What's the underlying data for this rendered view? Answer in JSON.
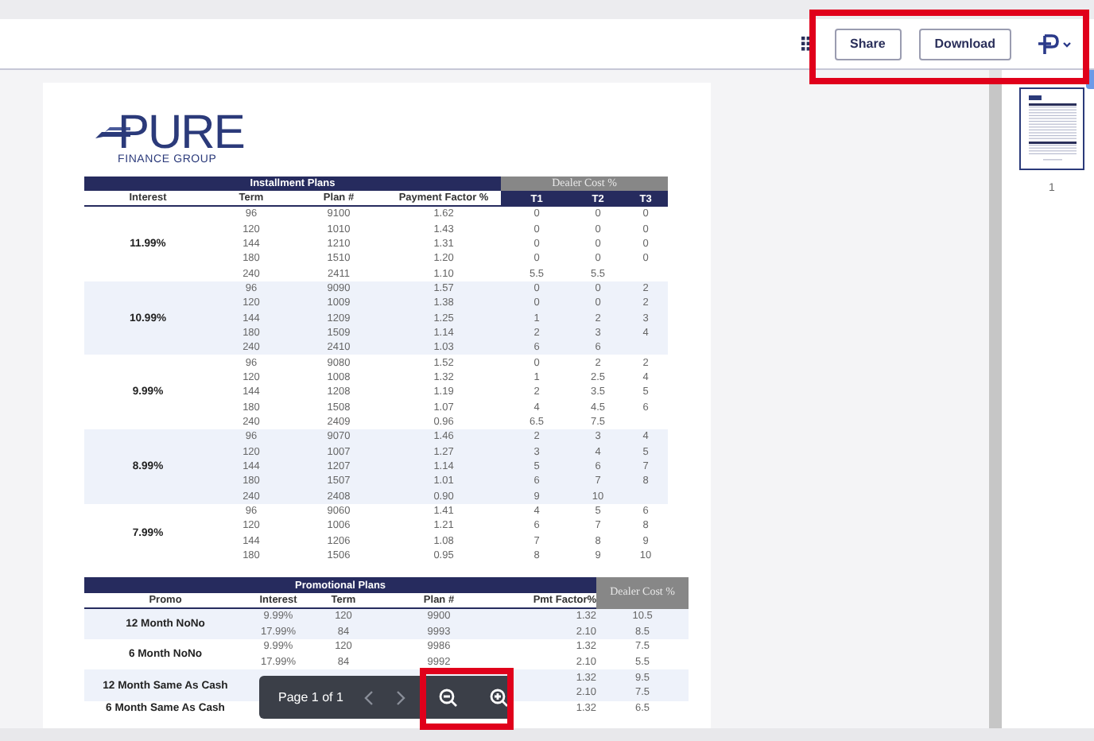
{
  "header": {
    "buttons": [
      {
        "label": "Share"
      },
      {
        "label": "Download"
      }
    ]
  },
  "document": {
    "logo": {
      "name": "PURE",
      "tagline": "FINANCE GROUP"
    },
    "installment": {
      "title": "Installment Plans",
      "dealer_title": "Dealer Cost %",
      "columns": [
        "Interest",
        "Term",
        "Plan #",
        "Payment Factor %",
        "T1",
        "T2",
        "T3"
      ],
      "groups": [
        {
          "interest": "11.99%",
          "rows": [
            [
              "96",
              "9100",
              "1.62",
              "0",
              "0",
              "0"
            ],
            [
              "120",
              "1010",
              "1.43",
              "0",
              "0",
              "0"
            ],
            [
              "144",
              "1210",
              "1.31",
              "0",
              "0",
              "0"
            ],
            [
              "180",
              "1510",
              "1.20",
              "0",
              "0",
              "0"
            ],
            [
              "240",
              "2411",
              "1.10",
              "5.5",
              "5.5",
              null
            ]
          ]
        },
        {
          "interest": "10.99%",
          "rows": [
            [
              "96",
              "9090",
              "1.57",
              "0",
              "0",
              "2"
            ],
            [
              "120",
              "1009",
              "1.38",
              "0",
              "0",
              "2"
            ],
            [
              "144",
              "1209",
              "1.25",
              "1",
              "2",
              "3"
            ],
            [
              "180",
              "1509",
              "1.14",
              "2",
              "3",
              "4"
            ],
            [
              "240",
              "2410",
              "1.03",
              "6",
              "6",
              null
            ]
          ]
        },
        {
          "interest": "9.99%",
          "rows": [
            [
              "96",
              "9080",
              "1.52",
              "0",
              "2",
              "2"
            ],
            [
              "120",
              "1008",
              "1.32",
              "1",
              "2.5",
              "4"
            ],
            [
              "144",
              "1208",
              "1.19",
              "2",
              "3.5",
              "5"
            ],
            [
              "180",
              "1508",
              "1.07",
              "4",
              "4.5",
              "6"
            ],
            [
              "240",
              "2409",
              "0.96",
              "6.5",
              "7.5",
              null
            ]
          ]
        },
        {
          "interest": "8.99%",
          "rows": [
            [
              "96",
              "9070",
              "1.46",
              "2",
              "3",
              "4"
            ],
            [
              "120",
              "1007",
              "1.27",
              "3",
              "4",
              "5"
            ],
            [
              "144",
              "1207",
              "1.14",
              "5",
              "6",
              "7"
            ],
            [
              "180",
              "1507",
              "1.01",
              "6",
              "7",
              "8"
            ],
            [
              "240",
              "2408",
              "0.90",
              "9",
              "10",
              null
            ]
          ]
        },
        {
          "interest": "7.99%",
          "rows": [
            [
              "96",
              "9060",
              "1.41",
              "4",
              "5",
              "6"
            ],
            [
              "120",
              "1006",
              "1.21",
              "6",
              "7",
              "8"
            ],
            [
              "144",
              "1206",
              "1.08",
              "7",
              "8",
              "9"
            ],
            [
              "180",
              "1506",
              "0.95",
              "8",
              "9",
              "10"
            ]
          ]
        }
      ]
    },
    "promotional": {
      "title": "Promotional Plans",
      "dealer_title": "Dealer Cost %",
      "columns": [
        "Promo",
        "Interest",
        "Term",
        "Plan #",
        "Pmt Factor%"
      ],
      "groups": [
        {
          "promo": "12 Month NoNo",
          "rows": [
            [
              "9.99%",
              "120",
              "9900",
              "1.32",
              "10.5"
            ],
            [
              "17.99%",
              "84",
              "9993",
              "2.10",
              "8.5"
            ]
          ]
        },
        {
          "promo": "6 Month NoNo",
          "rows": [
            [
              "9.99%",
              "120",
              "9986",
              "1.32",
              "7.5"
            ],
            [
              "17.99%",
              "84",
              "9992",
              "2.10",
              "5.5"
            ]
          ]
        },
        {
          "promo": "12 Month Same As Cash",
          "rows": [
            [
              null,
              null,
              null,
              "1.32",
              "9.5"
            ],
            [
              null,
              null,
              null,
              "2.10",
              "7.5"
            ]
          ]
        },
        {
          "promo": "6 Month Same As Cash",
          "rows": [
            [
              null,
              null,
              null,
              "1.32",
              "6.5"
            ]
          ]
        }
      ]
    }
  },
  "thumbnails": [
    {
      "label": "1",
      "selected": true
    }
  ],
  "viewer_toolbar": {
    "page_label": "Page 1 of 1"
  }
}
